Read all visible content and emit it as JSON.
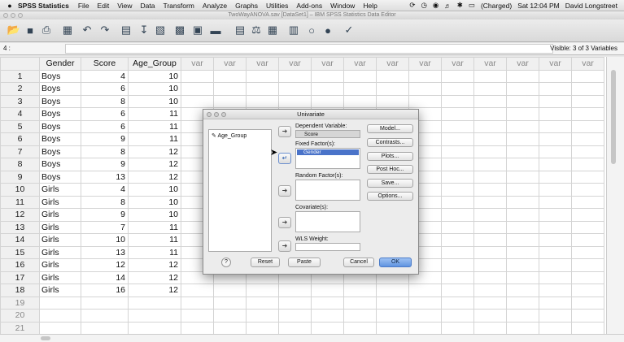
{
  "menubar": {
    "apple": "",
    "app": "SPSS Statistics",
    "items": [
      "File",
      "Edit",
      "View",
      "Data",
      "Transform",
      "Analyze",
      "Graphs",
      "Utilities",
      "Add-ons",
      "Window",
      "Help"
    ],
    "battery": "(Charged)",
    "clock": "Sat 12:04 PM",
    "user": "David Longstreet"
  },
  "window": {
    "title": "TwoWayANOVA.sav [DataSet1] – IBM SPSS Statistics Data Editor"
  },
  "cellbar": {
    "ref": "4 :",
    "visible": "Visible: 3 of 3 Variables"
  },
  "grid": {
    "columns": [
      "Gender",
      "Score",
      "Age_Group",
      "var",
      "var",
      "var",
      "var",
      "var",
      "var",
      "var",
      "var",
      "var",
      "var",
      "var",
      "var",
      "var"
    ],
    "rows": [
      {
        "n": "1",
        "gender": "Boys",
        "score": "4",
        "age": "10"
      },
      {
        "n": "2",
        "gender": "Boys",
        "score": "6",
        "age": "10"
      },
      {
        "n": "3",
        "gender": "Boys",
        "score": "8",
        "age": "10"
      },
      {
        "n": "4",
        "gender": "Boys",
        "score": "6",
        "age": "11"
      },
      {
        "n": "5",
        "gender": "Boys",
        "score": "6",
        "age": "11"
      },
      {
        "n": "6",
        "gender": "Boys",
        "score": "9",
        "age": "11"
      },
      {
        "n": "7",
        "gender": "Boys",
        "score": "8",
        "age": "12"
      },
      {
        "n": "8",
        "gender": "Boys",
        "score": "9",
        "age": "12"
      },
      {
        "n": "9",
        "gender": "Boys",
        "score": "13",
        "age": "12"
      },
      {
        "n": "10",
        "gender": "Girls",
        "score": "4",
        "age": "10"
      },
      {
        "n": "11",
        "gender": "Girls",
        "score": "8",
        "age": "10"
      },
      {
        "n": "12",
        "gender": "Girls",
        "score": "9",
        "age": "10"
      },
      {
        "n": "13",
        "gender": "Girls",
        "score": "7",
        "age": "11"
      },
      {
        "n": "14",
        "gender": "Girls",
        "score": "10",
        "age": "11"
      },
      {
        "n": "15",
        "gender": "Girls",
        "score": "13",
        "age": "11"
      },
      {
        "n": "16",
        "gender": "Girls",
        "score": "12",
        "age": "12"
      },
      {
        "n": "17",
        "gender": "Girls",
        "score": "14",
        "age": "12"
      },
      {
        "n": "18",
        "gender": "Girls",
        "score": "16",
        "age": "12"
      }
    ],
    "empty_rows": [
      "19",
      "20",
      "21"
    ]
  },
  "dialog": {
    "title": "Univariate",
    "source_var": "Age_Group",
    "dependent_label": "Dependent Variable:",
    "dependent_value": "Score",
    "fixed_label": "Fixed Factor(s):",
    "fixed_value": "Gender",
    "random_label": "Random Factor(s):",
    "covariate_label": "Covariate(s):",
    "wls_label": "WLS Weight:",
    "side_buttons": [
      "Model...",
      "Contrasts...",
      "Plots...",
      "Post Hoc...",
      "Save...",
      "Options..."
    ],
    "help": "?",
    "reset": "Reset",
    "paste": "Paste",
    "cancel": "Cancel",
    "ok": "OK"
  },
  "colors": {
    "selection": "#4a73c9",
    "ok_button": "#5f93e0"
  }
}
